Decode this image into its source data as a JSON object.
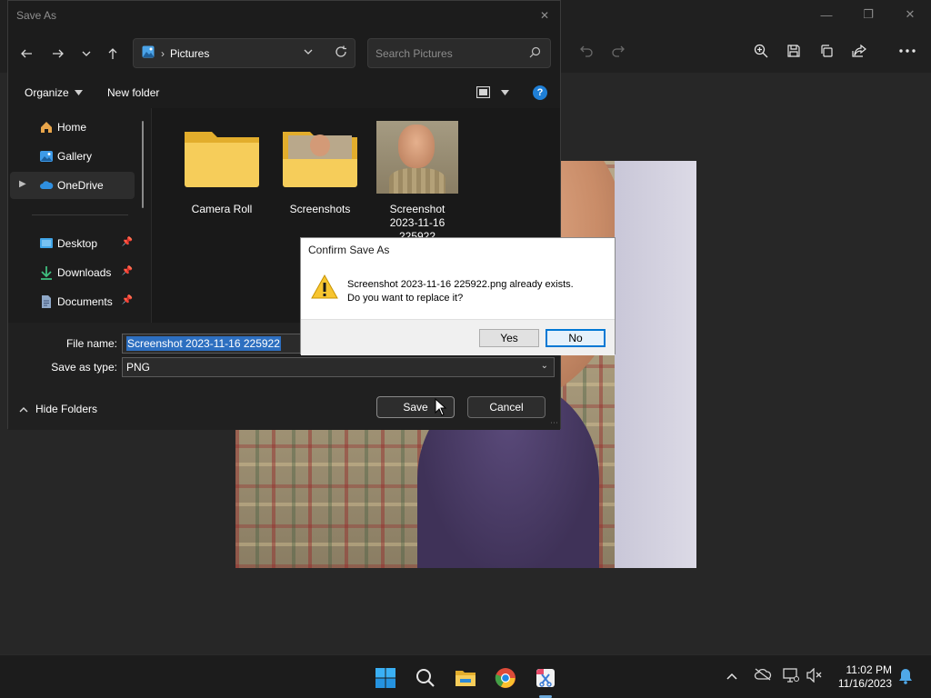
{
  "background_app": {
    "window_controls": [
      "minimize",
      "restore",
      "close"
    ],
    "toolbar_icons": [
      "undo-icon",
      "redo-icon",
      "zoom-in-icon",
      "save-icon",
      "copy-icon",
      "share-icon",
      "more-icon"
    ]
  },
  "save_as": {
    "title": "Save As",
    "address": {
      "location": "Pictures"
    },
    "search_placeholder": "Search Pictures",
    "commands": {
      "organize": "Organize",
      "new_folder": "New folder"
    },
    "nav": [
      {
        "label": "Home",
        "icon": "home-icon"
      },
      {
        "label": "Gallery",
        "icon": "gallery-icon"
      },
      {
        "label": "OneDrive",
        "icon": "onedrive-icon",
        "selected": true
      },
      {
        "label": "Desktop",
        "icon": "desktop-icon",
        "pinned": true
      },
      {
        "label": "Downloads",
        "icon": "downloads-icon",
        "pinned": true
      },
      {
        "label": "Documents",
        "icon": "documents-icon",
        "pinned": true
      }
    ],
    "files": [
      {
        "name": "Camera Roll",
        "type": "folder"
      },
      {
        "name": "Screenshots",
        "type": "folder-with-preview"
      },
      {
        "name_lines": [
          "Screenshot",
          "2023-11-16",
          "225922"
        ],
        "type": "image"
      }
    ],
    "file_name_label": "File name:",
    "file_name_value": "Screenshot 2023-11-16 225922",
    "save_type_label": "Save as type:",
    "save_type_value": "PNG",
    "hide_folders": "Hide Folders",
    "save_button": "Save",
    "cancel_button": "Cancel"
  },
  "confirm": {
    "title": "Confirm Save As",
    "message_line1": "Screenshot 2023-11-16 225922.png already exists.",
    "message_line2": "Do you want to replace it?",
    "yes": "Yes",
    "no": "No"
  },
  "taskbar": {
    "apps": [
      "windows-start-icon",
      "search-icon",
      "file-explorer-icon",
      "chrome-icon",
      "snipping-tool-icon"
    ],
    "time": "11:02 PM",
    "date": "11/16/2023"
  },
  "colors": {
    "accent": "#0078d4",
    "selection": "#2d6fc0",
    "folder": "#f3c64b"
  }
}
